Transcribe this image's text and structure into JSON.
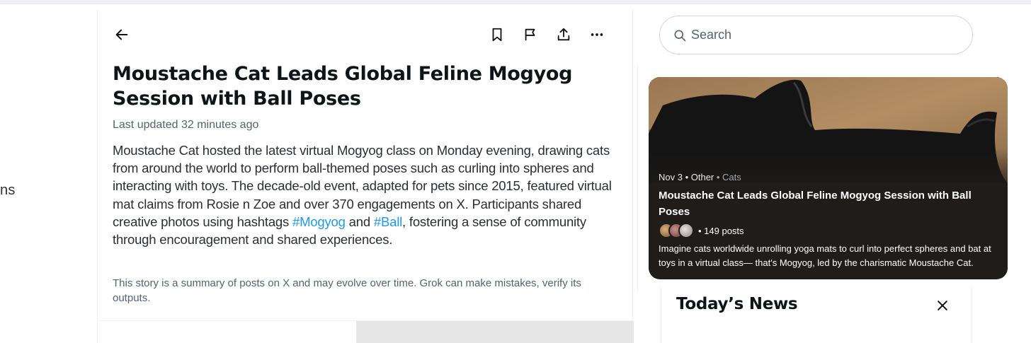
{
  "left_nav": {
    "partial_label": "ns"
  },
  "toolbar": {
    "back_icon": "arrow-left-icon",
    "bookmark_icon": "bookmark-icon",
    "flag_icon": "flag-icon",
    "share_icon": "share-icon",
    "more_icon": "more-horizontal-icon"
  },
  "story": {
    "headline": "Moustache Cat Leads Global Feline Mogyog Session with Ball Poses",
    "updated": "Last updated 32 minutes ago",
    "summary_part1": "Moustache Cat hosted the latest virtual Mogyog class on Monday evening, drawing cats from around the world to perform ball-themed poses such as curling into spheres and interacting with toys. The decade-old event, adapted for pets since 2015, featured virtual mat claims from Rosie n Zoe and over 370 engagements on X. Participants shared creative photos using hashtags ",
    "hashtag1": "#Mogyog",
    "summary_and": " and ",
    "hashtag2": "#Ball",
    "summary_part2": ", fostering a sense of community through encouragement and shared experiences.",
    "disclaimer": "This story is a summary of posts on X and may evolve over time. Grok can make mistakes, verify its outputs."
  },
  "search": {
    "placeholder": "Search",
    "icon": "search-icon"
  },
  "trend_card": {
    "date": "Nov 3",
    "category": "Other",
    "topic": "Cats",
    "title": "Moustache Cat Leads Global Feline Mogyog Session with Ball Poses",
    "posts": "149 posts",
    "description": "Imagine cats worldwide unrolling yoga mats to curl into perfect spheres and bat at toys in a virtual class— that's Mogyog, led by the charismatic Moustache Cat."
  },
  "news": {
    "title": "Today’s News",
    "close_icon": "close-icon"
  },
  "colors": {
    "accent": "#1d9bf0",
    "card_bg": "#1f1c1a",
    "text_primary": "#0f1419",
    "text_secondary": "#536471"
  }
}
